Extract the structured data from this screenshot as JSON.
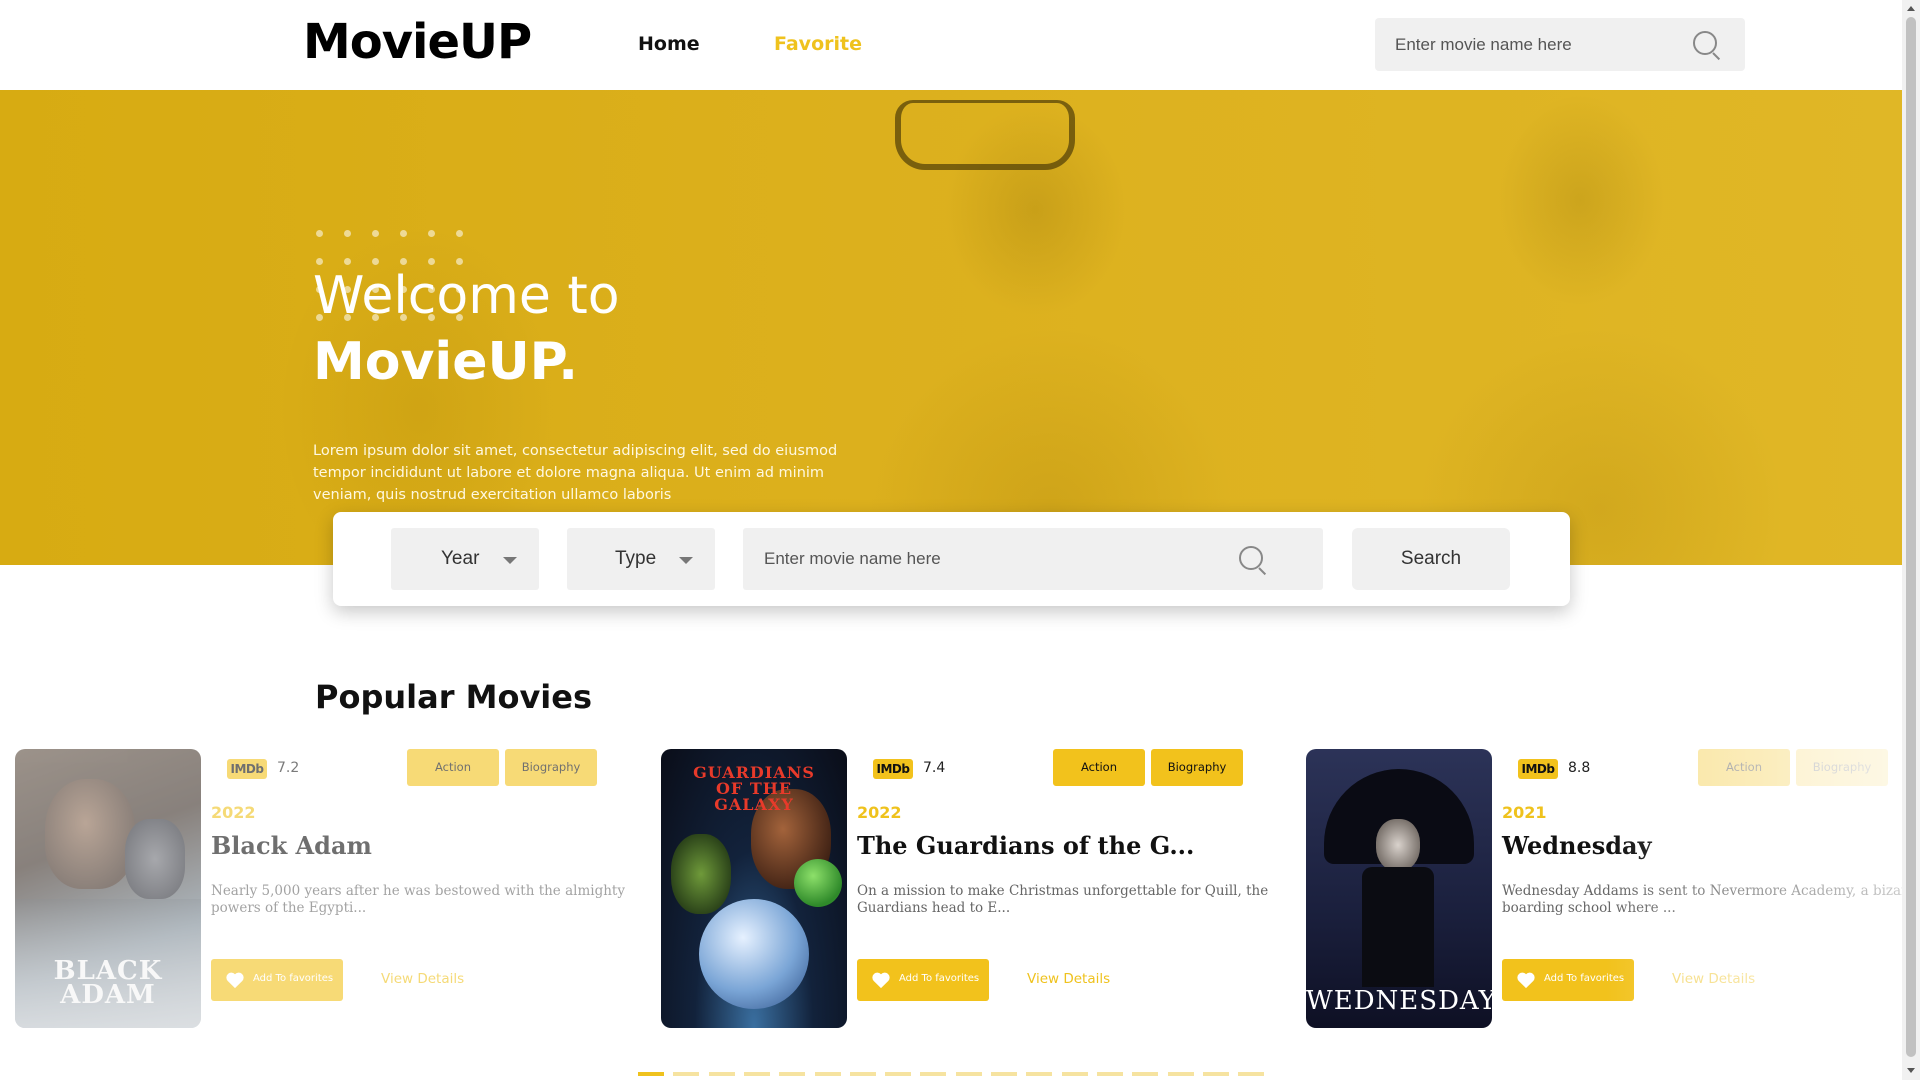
{
  "header": {
    "logo": "MovieUP",
    "nav": {
      "home": "Home",
      "favorite": "Favorite"
    },
    "search_placeholder": "Enter movie name here"
  },
  "hero": {
    "title_line1": "Welcome to",
    "title_line2": "MovieUP.",
    "description": "Lorem ipsum dolor sit amet, consectetur adipiscing elit, sed do eiusmod tempor incididunt ut labore et dolore magna aliqua. Ut enim ad minim veniam, quis nostrud exercitation ullamco laboris"
  },
  "search_panel": {
    "year_label": "Year",
    "type_label": "Type",
    "input_placeholder": "Enter movie name here",
    "button_label": "Search"
  },
  "popular": {
    "title": "Popular Movies",
    "movies": [
      {
        "imdb": "IMDb",
        "rating": "7.2",
        "tags": [
          "Action",
          "Biography"
        ],
        "year": "2022",
        "title": "Black Adam",
        "description": "Nearly 5,000 years after he was bestowed with the almighty powers of the Egypti...",
        "poster_text": "BLACK ADAM",
        "fav_label": "Add To favorites",
        "details_label": "View Details"
      },
      {
        "imdb": "IMDb",
        "rating": "7.4",
        "tags": [
          "Action",
          "Biography"
        ],
        "year": "2022",
        "title": "The Guardians of the G...",
        "description": "On a mission to make Christmas unforgettable for Quill, the Guardians head to E...",
        "poster_text": "GUARDIANS OF THE GALAXY",
        "fav_label": "Add To favorites",
        "details_label": "View Details"
      },
      {
        "imdb": "IMDb",
        "rating": "8.8",
        "tags": [
          "Action",
          "Biography"
        ],
        "year": "2021",
        "title": "Wednesday",
        "description": "Wednesday Addams is sent to Nevermore Academy, a bizarre boarding school where ...",
        "poster_text": "WEDNESDAY",
        "fav_label": "Add To favorites",
        "details_label": "View Details"
      }
    ],
    "pagination": {
      "total": 18,
      "active": 1
    }
  },
  "colors": {
    "accent": "#efc21d",
    "hero": "#d9ae17",
    "input_bg": "#f0f0f0"
  }
}
